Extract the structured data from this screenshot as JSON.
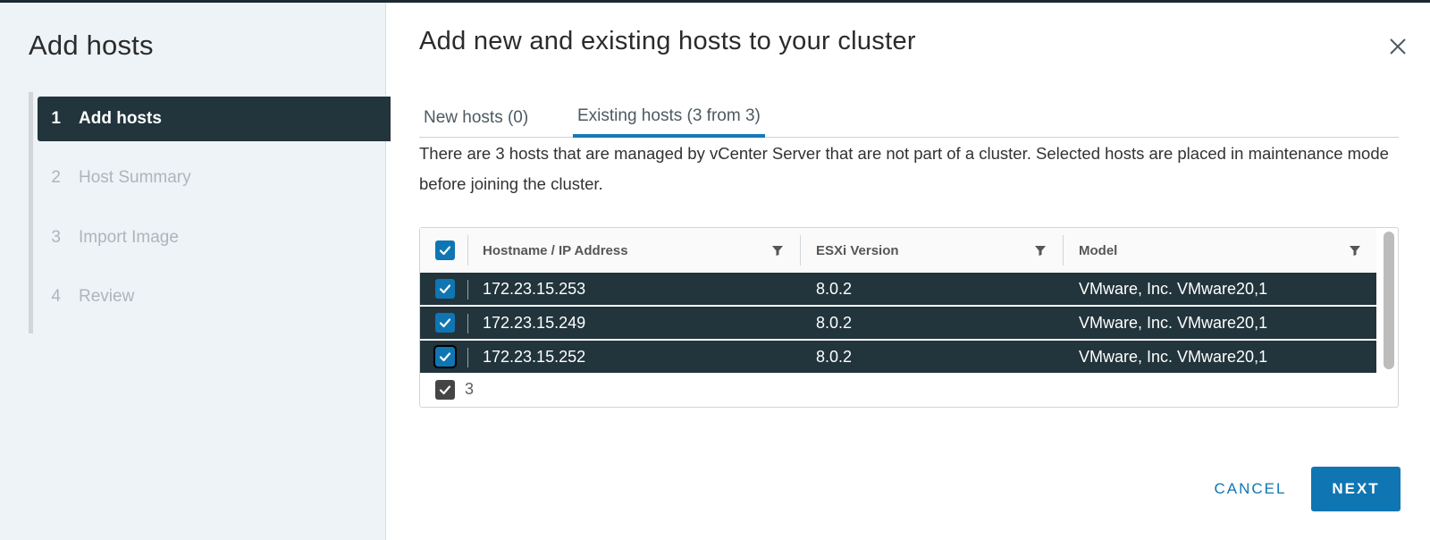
{
  "sidebar": {
    "title": "Add hosts",
    "steps": [
      {
        "num": "1",
        "label": "Add hosts",
        "active": true
      },
      {
        "num": "2",
        "label": "Host Summary",
        "active": false
      },
      {
        "num": "3",
        "label": "Import Image",
        "active": false
      },
      {
        "num": "4",
        "label": "Review",
        "active": false
      }
    ]
  },
  "main": {
    "title": "Add new and existing hosts to your cluster",
    "close_icon": "close-icon",
    "tabs": [
      {
        "label": "New hosts (0)",
        "active": false
      },
      {
        "label": "Existing hosts (3 from 3)",
        "active": true
      }
    ],
    "description": "There are 3 hosts that are managed by vCenter Server that are not part of a cluster. Selected hosts are placed in maintenance mode before joining the cluster."
  },
  "table": {
    "columns": [
      "Hostname / IP Address",
      "ESXi Version",
      "Model"
    ],
    "rows": [
      {
        "hostname": "172.23.15.253",
        "version": "8.0.2",
        "model": "VMware, Inc. VMware20,1",
        "checked": true
      },
      {
        "hostname": "172.23.15.249",
        "version": "8.0.2",
        "model": "VMware, Inc. VMware20,1",
        "checked": true
      },
      {
        "hostname": "172.23.15.252",
        "version": "8.0.2",
        "model": "VMware, Inc. VMware20,1",
        "checked": true
      }
    ],
    "selected_count": "3"
  },
  "buttons": {
    "cancel": "CANCEL",
    "next": "NEXT"
  },
  "colors": {
    "accent": "#0f76b3",
    "selected_row": "#22343c",
    "sidebar_bg": "#eef3f7"
  }
}
